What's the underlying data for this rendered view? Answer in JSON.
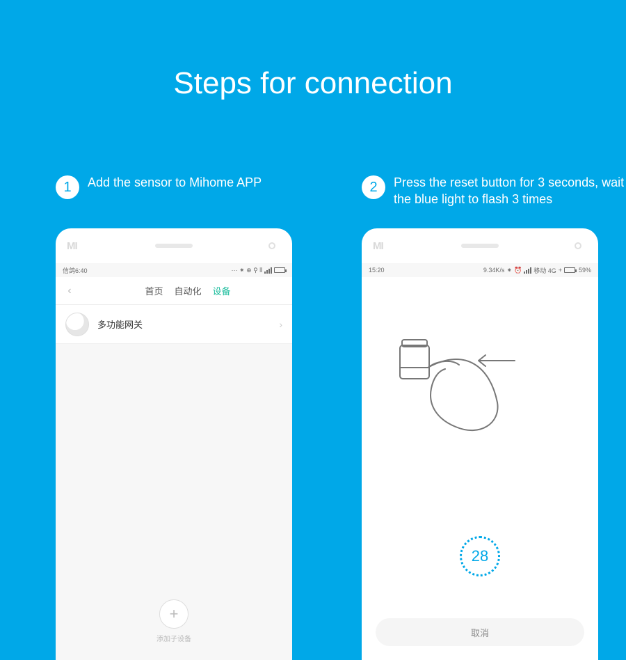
{
  "title": "Steps for connection",
  "steps": [
    {
      "num": "1",
      "text": "Add the sensor to Mihome APP"
    },
    {
      "num": "2",
      "text": "Press the reset button for 3 seconds, wait the blue light to flash 3 times"
    }
  ],
  "phone1": {
    "logo": "MI",
    "status": {
      "time": "信鸽6:40",
      "icons": "··· ⁕ ⊕ ⚲ ⫴"
    },
    "tabs": [
      "首页",
      "自动化",
      "设备"
    ],
    "active_tab_index": 2,
    "device_label": "多功能网关",
    "add_label": "添加子设备"
  },
  "phone2": {
    "logo": "MI",
    "status": {
      "time": "15:20",
      "speed": "9.34K/s",
      "net": "移动 4G",
      "battery_pct": "59%"
    },
    "countdown": "28",
    "cancel": "取消"
  }
}
